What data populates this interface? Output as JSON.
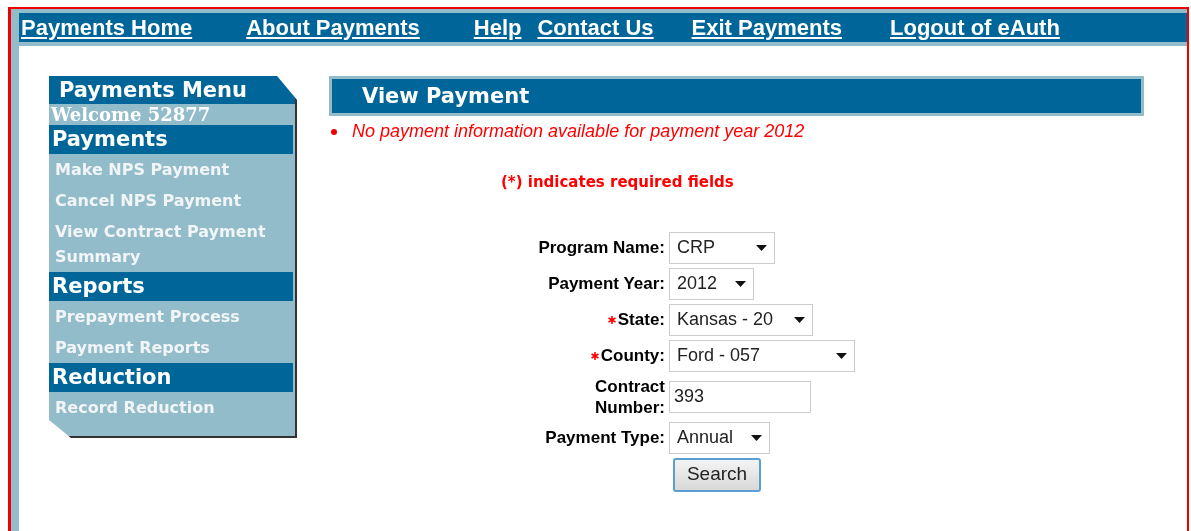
{
  "nav": [
    {
      "label": "Payments Home"
    },
    {
      "label": "About Payments"
    },
    {
      "label": "Help"
    },
    {
      "label": "Contact Us"
    },
    {
      "label": "Exit Payments"
    },
    {
      "label": "Logout of eAuth"
    }
  ],
  "sidebar": {
    "title": "Payments Menu",
    "welcome": "Welcome 52877",
    "sections": [
      {
        "heading": "Payments",
        "items": [
          "Make NPS Payment",
          "Cancel NPS Payment",
          "View Contract Payment Summary"
        ]
      },
      {
        "heading": "Reports",
        "items": [
          "Prepayment Process",
          "Payment Reports"
        ]
      },
      {
        "heading": "Reduction",
        "items": [
          "Record Reduction"
        ]
      }
    ]
  },
  "main": {
    "title": "View Payment",
    "errors": [
      "No payment information available for payment year 2012"
    ],
    "required_note": "(*) indicates required fields",
    "fields": [
      {
        "label": "Program Name:",
        "kind": "select",
        "value": "CRP",
        "required": false
      },
      {
        "label": "Payment Year:",
        "kind": "select",
        "value": "2012",
        "required": false
      },
      {
        "label": "State:",
        "kind": "select",
        "value": "Kansas - 20",
        "required": true
      },
      {
        "label": "County:",
        "kind": "select",
        "value": "Ford - 057",
        "required": true
      },
      {
        "label": "Contract Number:",
        "kind": "text",
        "value": "393",
        "required": false
      },
      {
        "label": "Payment Type:",
        "kind": "select",
        "value": "Annual",
        "required": false
      }
    ],
    "button": "Search"
  }
}
